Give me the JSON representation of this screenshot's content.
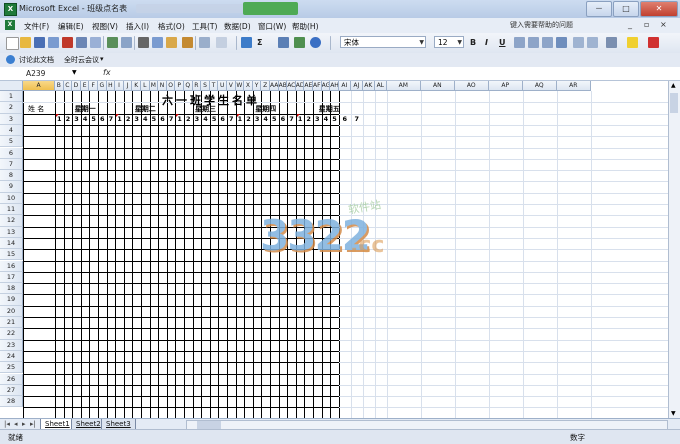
{
  "window": {
    "app_name": "Microsoft Excel",
    "doc_name": "班级点名表",
    "help_placeholder": "键入需要帮助的问题",
    "green_button": "",
    "min_label": "－",
    "max_label": "□",
    "close_label": "✕"
  },
  "menu": {
    "items": [
      "文件(F)",
      "编辑(E)",
      "视图(V)",
      "插入(I)",
      "格式(O)",
      "工具(T)",
      "数据(D)",
      "窗口(W)",
      "帮助(H)"
    ]
  },
  "toolbar": {
    "font_name": "宋体",
    "font_size": "12",
    "bold": "B",
    "italic": "I",
    "underline": "U"
  },
  "toolbar2": {
    "discuss": "讨论此文档",
    "meeting": "全时云会议"
  },
  "formula_bar": {
    "cell_ref": "A239",
    "fx": "fx",
    "content": ""
  },
  "sheet": {
    "columns": [
      "A",
      "B",
      "C",
      "D",
      "E",
      "F",
      "G",
      "H",
      "I",
      "J",
      "K",
      "L",
      "M",
      "N",
      "O",
      "P",
      "Q",
      "R",
      "S",
      "T",
      "U",
      "V",
      "W",
      "X",
      "Y",
      "Z",
      "AA",
      "AB",
      "AC",
      "AD",
      "AE",
      "AF",
      "AG",
      "AH",
      "AI",
      "AJ",
      "AK",
      "AL",
      "AM",
      "AN",
      "AO",
      "AP",
      "AQ",
      "AR"
    ],
    "rows": [
      "1",
      "2",
      "3",
      "4",
      "5",
      "6",
      "7",
      "8",
      "9",
      "10",
      "11",
      "12",
      "13",
      "14",
      "15",
      "16",
      "17",
      "18",
      "19",
      "20",
      "21",
      "22",
      "23",
      "24",
      "25",
      "26",
      "27",
      "28"
    ],
    "title": "六一班学生名单",
    "name_header": "姓 名",
    "weekdays": [
      "星期一",
      "星期二",
      "星期三",
      "星期四",
      "星期五"
    ],
    "period_nums": [
      "1",
      "2",
      "3",
      "4",
      "5",
      "6",
      "7"
    ],
    "selected_cell": "A239"
  },
  "watermark": {
    "big": "3322",
    "cc": ".cc",
    "sub": "软件站"
  },
  "tabs": {
    "sheets": [
      "Sheet1",
      "Sheet2",
      "Sheet3"
    ],
    "active": "Sheet1"
  },
  "status": {
    "ready": "就绪",
    "mode": "数字"
  },
  "colors": {
    "accent": "#1f7a3a",
    "header_bg": "#dde6f2",
    "grid_light": "#d8e0ec",
    "grid_dark": "#000000"
  }
}
